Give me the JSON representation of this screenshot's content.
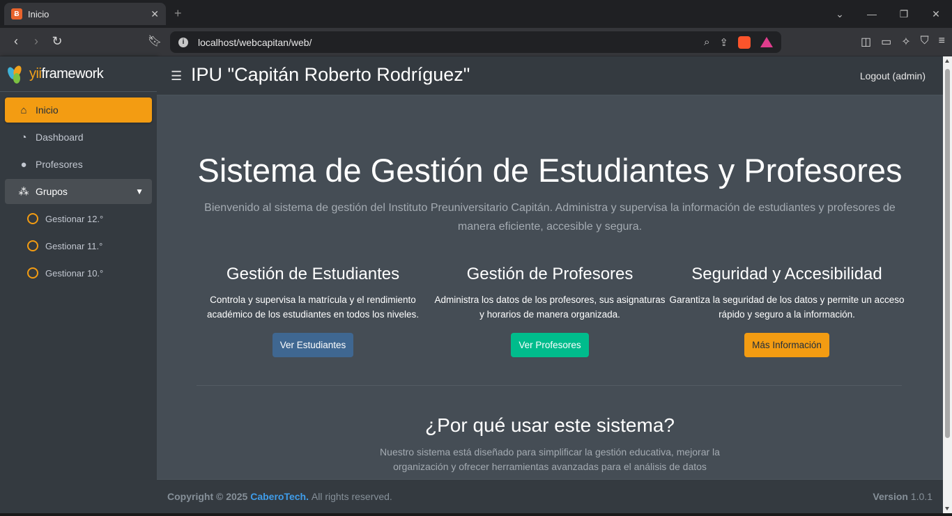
{
  "browser": {
    "tab_title": "Inicio",
    "tab_favicon": "yii-favicon",
    "url": "localhost/webcapitan/web/",
    "new_tab": "+",
    "close_tab": "✕"
  },
  "sidebar": {
    "brand_prefix": "yii",
    "brand_suffix": "framework",
    "items": [
      {
        "label": "Inicio",
        "icon": "home-icon",
        "active": true
      },
      {
        "label": "Dashboard",
        "icon": "tachometer-icon"
      },
      {
        "label": "Profesores",
        "icon": "user-icon"
      },
      {
        "label": "Grupos",
        "icon": "users-icon",
        "expanded": true
      }
    ],
    "subitems": [
      {
        "label": "Gestionar 12.°"
      },
      {
        "label": "Gestionar 11.°"
      },
      {
        "label": "Gestionar 10.°"
      }
    ]
  },
  "header": {
    "title": "IPU \"Capitán Roberto Rodríguez\"",
    "logout": "Logout (admin)"
  },
  "hero": {
    "title": "Sistema de Gestión de Estudiantes y Profesores",
    "subtitle": "Bienvenido al sistema de gestión del Instituto Preuniversitario Capitán. Administra y supervisa la información de estudiantes y profesores de manera eficiente, accesible y segura."
  },
  "features": [
    {
      "title": "Gestión de Estudiantes",
      "text": "Controla y supervisa la matrícula y el rendimiento académico de los estudiantes en todos los niveles.",
      "button": "Ver Estudiantes"
    },
    {
      "title": "Gestión de Profesores",
      "text": "Administra los datos de los profesores, sus asignaturas y horarios de manera organizada.",
      "button": "Ver Profesores"
    },
    {
      "title": "Seguridad y Accesibilidad",
      "text": "Garantiza la seguridad de los datos y permite un acceso rápido y seguro a la información.",
      "button": "Más Información"
    }
  ],
  "why": {
    "title": "¿Por qué usar este sistema?",
    "text": "Nuestro sistema está diseñado para simplificar la gestión educativa, mejorar la organización y ofrecer herramientas avanzadas para el análisis de datos"
  },
  "footer": {
    "copyright": "Copyright © 2025",
    "brand": "CaberoTech.",
    "rights": "All rights reserved.",
    "version_label": "Version",
    "version_number": "1.0.1"
  },
  "colors": {
    "accent": "#f39c12",
    "sidebar_bg": "#343a40",
    "content_bg": "#454d55",
    "btn_blue": "#3f6791",
    "btn_green": "#00bc8c",
    "link": "#3f9dea"
  }
}
